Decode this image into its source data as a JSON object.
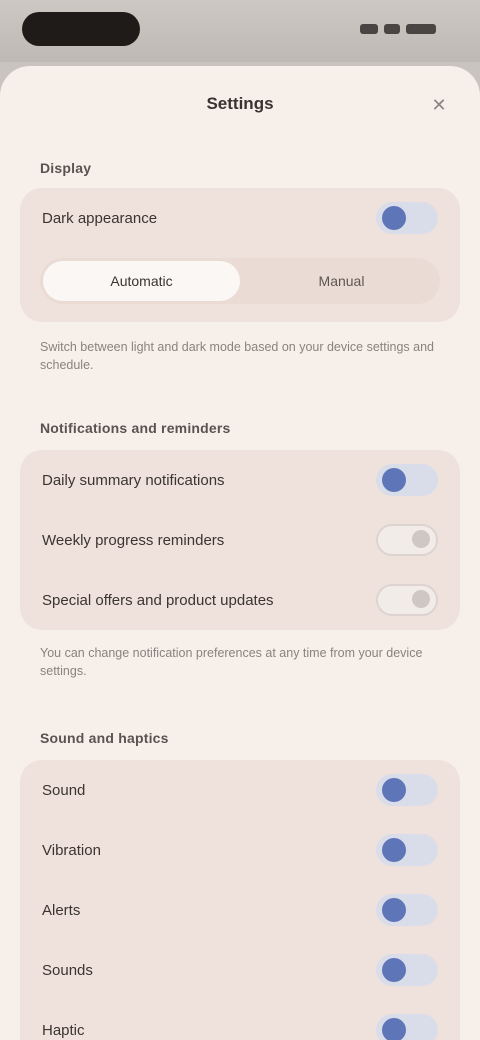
{
  "sheet": {
    "title": "Settings",
    "close_icon": "close-icon"
  },
  "section1": {
    "title": "Display",
    "row": {
      "label": "Dark appearance",
      "on": true
    },
    "segments": [
      "Automatic",
      "Manual"
    ],
    "selected_segment": 0,
    "help": "Switch between light and dark mode based on your device settings and schedule."
  },
  "section2": {
    "title": "Notifications and reminders",
    "rows": [
      {
        "label": "Daily summary notifications",
        "on": true
      },
      {
        "label": "Weekly progress reminders",
        "on": false
      },
      {
        "label": "Special offers and product updates",
        "on": false
      }
    ],
    "help": "You can change notification preferences at any time from your device settings."
  },
  "section3": {
    "title": "Sound and haptics",
    "rows": [
      {
        "label": "Sound",
        "on": true
      },
      {
        "label": "Vibration",
        "on": true
      },
      {
        "label": "Alerts",
        "on": true
      },
      {
        "label": "Sounds",
        "on": true
      },
      {
        "label": "Haptic",
        "on": true
      }
    ]
  }
}
